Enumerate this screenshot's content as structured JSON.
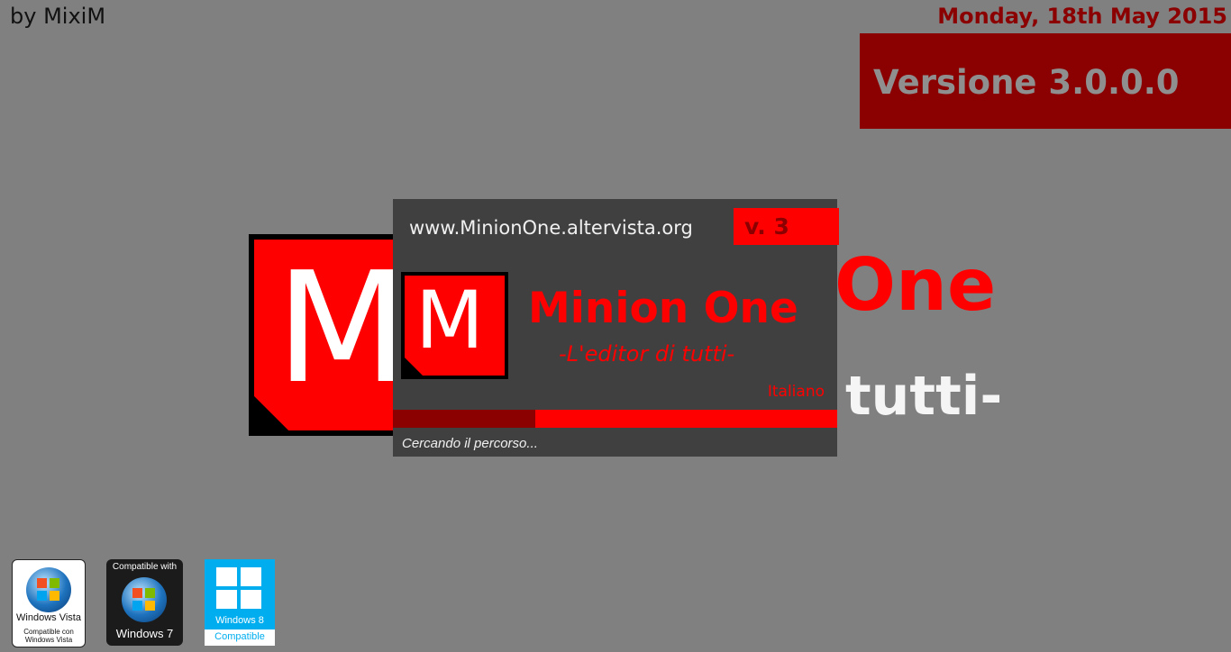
{
  "header": {
    "credit": "by MixiM",
    "date": "Monday, 18th May 2015",
    "version": "Versione 3.0.0.0"
  },
  "background": {
    "logo_letter": "M",
    "title": "One",
    "subtitle": "tutti-"
  },
  "splash": {
    "url": "www.MinionOne.altervista.org",
    "version_badge": "v. 3",
    "logo_letter": "M",
    "title": "Minion One",
    "subtitle": "-L'editor di tutti-",
    "language": "Italiano",
    "progress_fraction": 0.32,
    "status": "Cercando il percorso..."
  },
  "badges": {
    "vista": {
      "label": "Windows Vista",
      "sublabel": "Compatible con Windows Vista"
    },
    "win7": {
      "top": "Compatible with",
      "label": "Windows 7"
    },
    "win8": {
      "label": "Windows 8",
      "sublabel": "Compatible"
    }
  },
  "colors": {
    "background": "#808080",
    "accent_red": "#ff0000",
    "dark_red": "#8b0000",
    "splash_bg": "#404040"
  }
}
